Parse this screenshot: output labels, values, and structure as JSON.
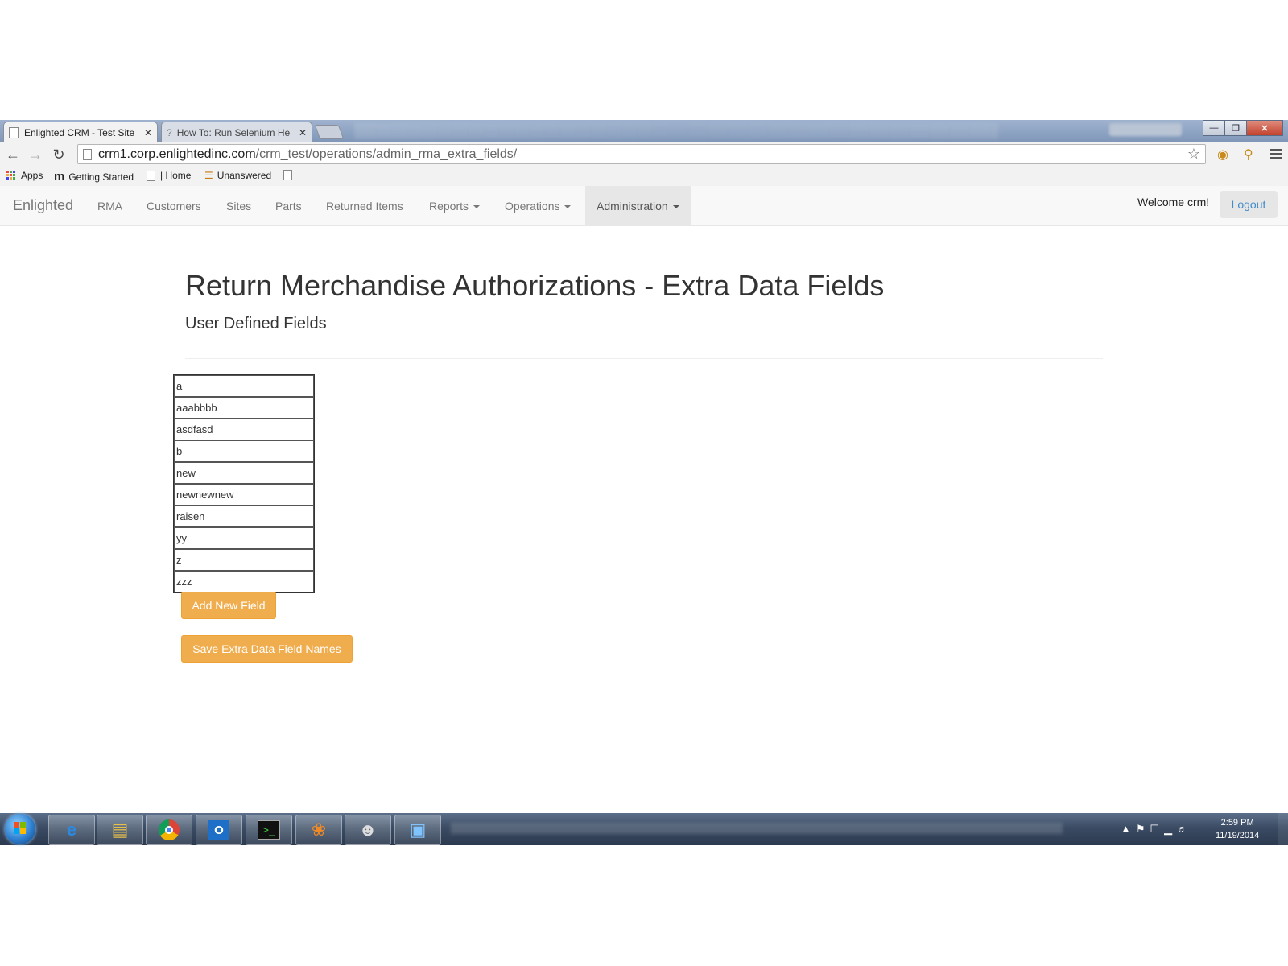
{
  "browser": {
    "tabs": [
      {
        "title": "Enlighted CRM - Test Site",
        "close": "✕",
        "active": true
      },
      {
        "title": "How To: Run Selenium He",
        "close": "✕",
        "active": false
      }
    ],
    "window_controls": {
      "minimize": "—",
      "maximize": "❐",
      "close": "✕"
    },
    "url": {
      "host": "crm1.corp.enlightedinc.com",
      "path": "/crm_test/operations/admin_rma_extra_fields/"
    },
    "bookmarks": [
      {
        "label": "Apps",
        "icon": "apps-grid-icon"
      },
      {
        "label": "Getting Started",
        "icon": "m-icon"
      },
      {
        "label": "| Home",
        "icon": "page-icon"
      },
      {
        "label": "Unanswered",
        "icon": "stackoverflow-icon"
      },
      {
        "label": "",
        "icon": "page-icon"
      }
    ]
  },
  "navbar": {
    "brand": "Enlighted",
    "items": [
      {
        "label": "RMA",
        "dropdown": false
      },
      {
        "label": "Customers",
        "dropdown": false
      },
      {
        "label": "Sites",
        "dropdown": false
      },
      {
        "label": "Parts",
        "dropdown": false
      },
      {
        "label": "Returned Items",
        "dropdown": false
      },
      {
        "label": "Reports",
        "dropdown": true
      },
      {
        "label": "Operations",
        "dropdown": true
      },
      {
        "label": "Administration",
        "dropdown": true,
        "active": true
      }
    ],
    "welcome": "Welcome crm!",
    "logout": "Logout"
  },
  "page": {
    "title": "Return Merchandise Authorizations - Extra Data Fields",
    "subtitle": "User Defined Fields",
    "fields": [
      "a",
      "aaabbbb",
      "asdfasd",
      "b",
      "new",
      "newnewnew",
      "raisen",
      "yy",
      "z",
      "zzz"
    ],
    "add_button": "Add New Field",
    "save_button": "Save Extra Data Field Names"
  },
  "taskbar": {
    "apps": [
      "internet-explorer-icon",
      "file-explorer-icon",
      "chrome-icon",
      "outlook-icon",
      "terminal-icon",
      "app-icon",
      "gimp-icon",
      "image-viewer-icon"
    ],
    "time": "2:59 PM",
    "date": "11/19/2014"
  },
  "colors": {
    "accent_button": "#f0ad4e",
    "link": "#428bca",
    "navbar_bg": "#f8f8f8"
  }
}
